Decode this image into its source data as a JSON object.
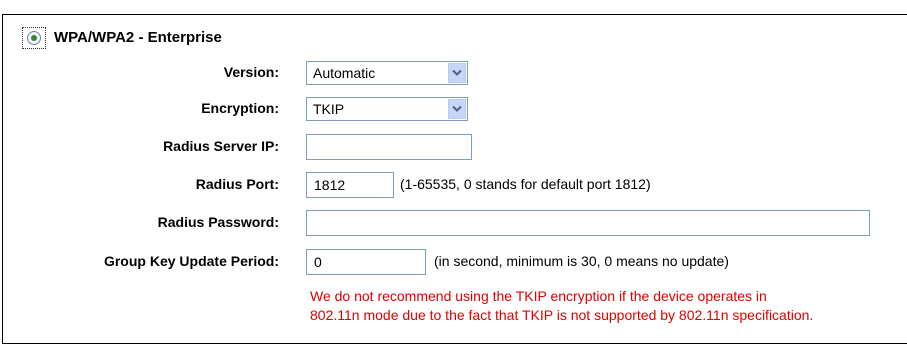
{
  "mode": {
    "title": "WPA/WPA2 - Enterprise",
    "selected": true,
    "icon": "radio-selected-icon"
  },
  "fields": {
    "version": {
      "label": "Version:",
      "value": "Automatic",
      "icon": "chevron-down-icon"
    },
    "encryption": {
      "label": "Encryption:",
      "value": "TKIP",
      "icon": "chevron-down-icon"
    },
    "radius_server_ip": {
      "label": "Radius Server IP:",
      "value": ""
    },
    "radius_port": {
      "label": "Radius Port:",
      "value": "1812",
      "hint": "(1-65535, 0 stands for default port 1812)"
    },
    "radius_password": {
      "label": "Radius Password:",
      "value": ""
    },
    "group_key_update_period": {
      "label": "Group Key Update Period:",
      "value": "0",
      "hint": "(in second, minimum is 30, 0 means no update)"
    }
  },
  "warning": {
    "line1": "We do not recommend using the TKIP encryption if the device operates in",
    "line2": "802.11n mode due to the fact that TKIP is not supported by 802.11n specification."
  },
  "colors": {
    "warning": "#e00000",
    "radio_dot": "#2b8a2b",
    "input_border": "#7f9db9",
    "dropdown_button": "#c6d6f7"
  }
}
